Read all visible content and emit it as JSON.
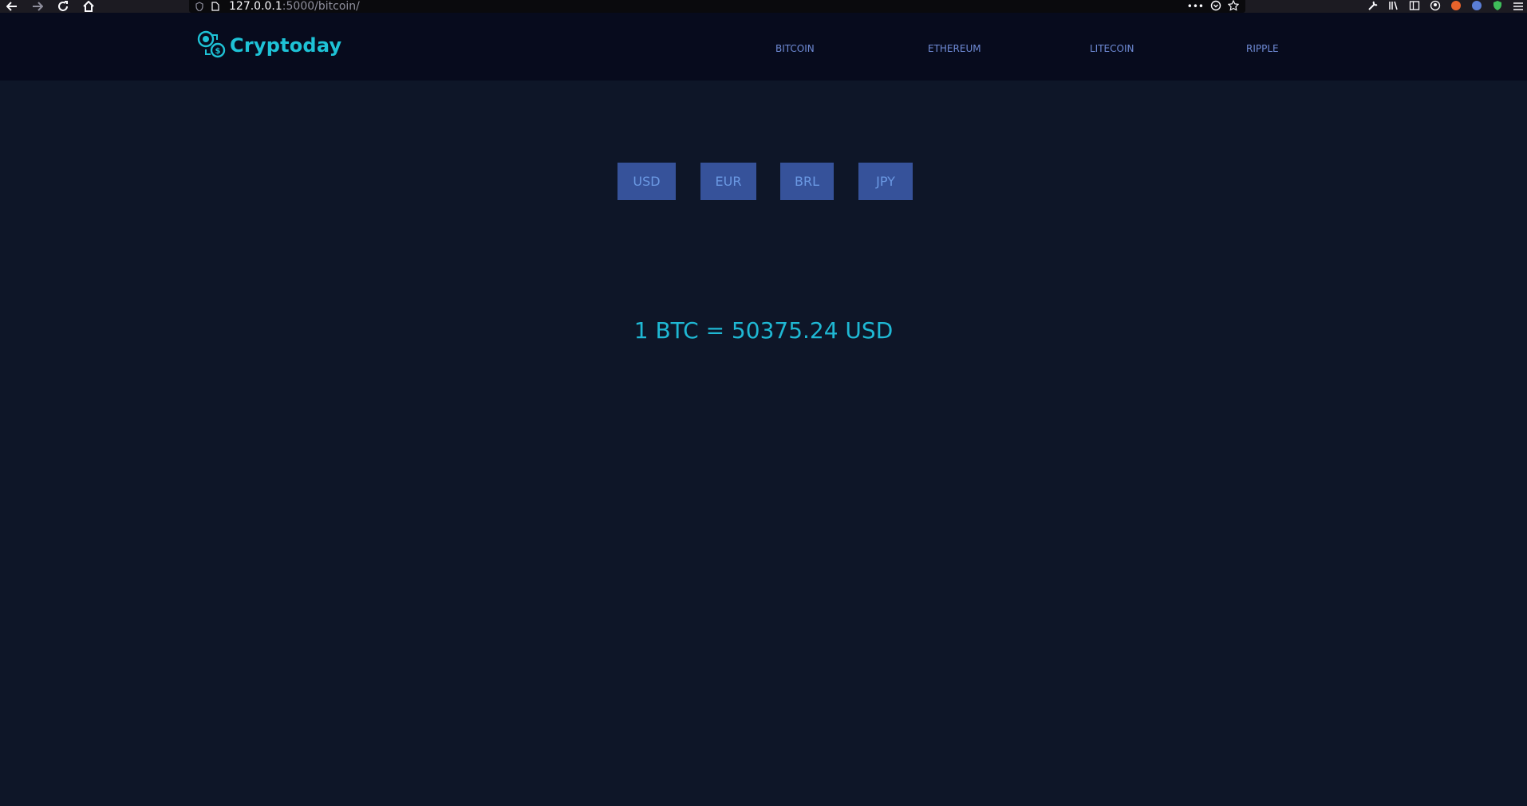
{
  "browser": {
    "url_host": "127.0.0.1",
    "url_path": ":5000/bitcoin/"
  },
  "site": {
    "logo_text": "Cryptoday",
    "brand_color": "#1ec2d6",
    "nav": [
      "BITCOIN",
      "ETHEREUM",
      "LITECOIN",
      "RIPPLE"
    ]
  },
  "currencies": [
    "USD",
    "EUR",
    "BRL",
    "JPY"
  ],
  "rate": {
    "text": "1 BTC = 50375.24 USD"
  }
}
